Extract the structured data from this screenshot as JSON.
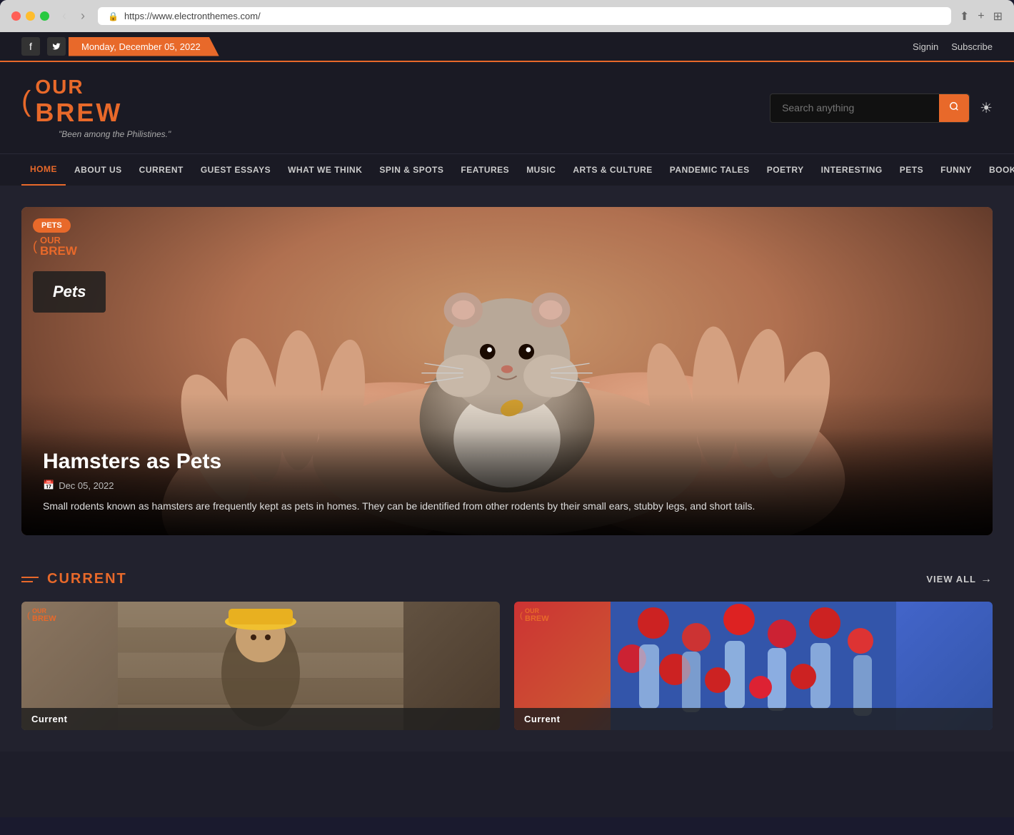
{
  "browser": {
    "url": "https://www.electronthemes.com/",
    "back_disabled": true,
    "forward_disabled": false
  },
  "topbar": {
    "date": "Monday, December 05, 2022",
    "signin_label": "Signin",
    "subscribe_label": "Subscribe",
    "facebook_icon": "f",
    "twitter_icon": "t"
  },
  "header": {
    "logo_our": "OUR",
    "logo_brew": "BREW",
    "logo_icon": "(",
    "tagline": "\"Been among the Philistines.\"",
    "search_placeholder": "Search anything",
    "theme_icon": "☀"
  },
  "nav": {
    "items": [
      {
        "label": "HOME",
        "active": true
      },
      {
        "label": "ABOUT US",
        "active": false
      },
      {
        "label": "CURRENT",
        "active": false
      },
      {
        "label": "GUEST ESSAYS",
        "active": false
      },
      {
        "label": "WHAT WE THINK",
        "active": false
      },
      {
        "label": "SPIN & SPOTS",
        "active": false
      },
      {
        "label": "FEATURES",
        "active": false
      },
      {
        "label": "MUSIC",
        "active": false
      },
      {
        "label": "ARTS & CULTURE",
        "active": false
      },
      {
        "label": "PANDEMIC TALES",
        "active": false
      },
      {
        "label": "POETRY",
        "active": false
      },
      {
        "label": "INTERESTING",
        "active": false
      },
      {
        "label": "PETS",
        "active": false
      },
      {
        "label": "FUNNY",
        "active": false
      },
      {
        "label": "BOOKS",
        "active": false
      }
    ]
  },
  "hero": {
    "category": "Pets",
    "logo_our": "OUR",
    "logo_brew": "BREW",
    "caption": "Pets",
    "title": "Hamsters as Pets",
    "date": "Dec 05, 2022",
    "date_icon": "📅",
    "excerpt": "Small rodents known as hamsters are frequently kept as pets in homes. They can be identified from other rodents by their small ears, stubby legs, and short tails."
  },
  "current_section": {
    "title": "CURRENT",
    "view_all": "VIEW ALL",
    "cards": [
      {
        "logo_our": "OUR",
        "logo_brew": "BREW",
        "category": "Current"
      },
      {
        "logo_our": "OUR",
        "logo_brew": "BREW",
        "category": "Current"
      }
    ]
  }
}
